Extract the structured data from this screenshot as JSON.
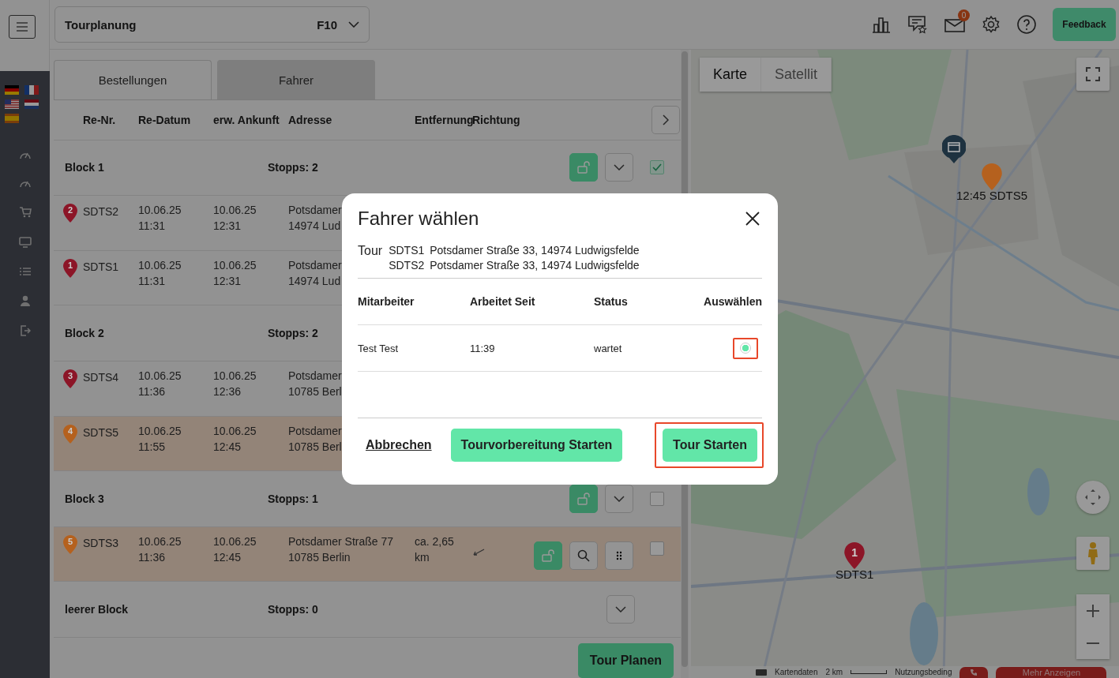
{
  "header": {
    "module_select": {
      "value": "Tourplanung",
      "shortcut": "F10"
    },
    "mail_badge": "0",
    "feedback_button": "Feedback"
  },
  "tabs": [
    {
      "label": "Bestellungen",
      "selected": false
    },
    {
      "label": "Fahrer",
      "selected": true
    }
  ],
  "table": {
    "columns": [
      "Re-Nr.",
      "Re-Datum",
      "erw. Ankunft",
      "Adresse",
      "Entfernung",
      "Richtung"
    ],
    "blocks": [
      {
        "name": "Block 1",
        "stops_label": "Stopps: 2",
        "kind": "full",
        "checked": true,
        "stops": [
          {
            "marker": "2",
            "color": "#8c1527",
            "id": "SDTS2",
            "date": "10.06.25",
            "date_time": "11:31",
            "arrival": "10.06.25",
            "arrival_time": "12:31",
            "address": [
              "Potsdamer",
              "14974 Lud"
            ],
            "highlighted": false
          },
          {
            "marker": "1",
            "color": "#8c1527",
            "id": "SDTS1",
            "date": "10.06.25",
            "date_time": "11:31",
            "arrival": "10.06.25",
            "arrival_time": "12:31",
            "address": [
              "Potsdamer",
              "14974 Lud"
            ],
            "highlighted": false
          }
        ]
      },
      {
        "name": "Block 2",
        "stops_label": "Stopps: 2",
        "stops": [
          {
            "marker": "3",
            "color": "#8c1527",
            "id": "SDTS4",
            "date": "10.06.25",
            "date_time": "11:36",
            "arrival": "10.06.25",
            "arrival_time": "12:36",
            "address": [
              "Potsdamer",
              "10785 Berl"
            ],
            "highlighted": false
          },
          {
            "marker": "4",
            "color": "#b5611e",
            "id": "SDTS5",
            "date": "10.06.25",
            "date_time": "11:55",
            "arrival": "10.06.25",
            "arrival_time": "12:45",
            "address": [
              "Potsdamer",
              "10785 Berl"
            ],
            "highlighted": true
          }
        ]
      },
      {
        "name": "Block 3",
        "stops_label": "Stopps: 1",
        "kind": "full",
        "checked": false,
        "stops": [
          {
            "marker": "5",
            "color": "#b5611e",
            "id": "SDTS3",
            "date": "10.06.25",
            "date_time": "11:36",
            "arrival": "10.06.25",
            "arrival_time": "12:45",
            "address": [
              "Potsdamer Straße 77",
              "10785 Berlin"
            ],
            "distance": [
              "ca. 2,65",
              "km"
            ],
            "checked": false,
            "highlighted": true
          }
        ]
      },
      {
        "name": "leerer Block",
        "stops_label": "Stopps: 0",
        "kind": "caret"
      }
    ],
    "plan_button": "Tour Planen"
  },
  "map": {
    "type_tabs": [
      {
        "label": "Karte",
        "selected": true
      },
      {
        "label": "Satellit",
        "selected": false
      }
    ],
    "markers": [
      {
        "kind": "store",
        "color": "#1e3240"
      },
      {
        "kind": "pin",
        "label": "12:45 SDTS5",
        "color": "#b5611e"
      },
      {
        "kind": "pin",
        "number": "1",
        "label": "SDTS1",
        "color": "#8c1527"
      }
    ],
    "footer": {
      "data": "Kartendaten",
      "scale": "2 km",
      "terms": "Nutzungsbeding",
      "more": "Mehr Anzeigen"
    }
  },
  "dialog": {
    "title": "Fahrer wählen",
    "tour_label": "Tour",
    "tour": [
      {
        "id": "SDTS1",
        "address": "Potsdamer Straße 33, 14974 Ludwigsfelde"
      },
      {
        "id": "SDTS2",
        "address": "Potsdamer Straße 33, 14974 Ludwigsfelde"
      }
    ],
    "columns": [
      "Mitarbeiter",
      "Arbeitet Seit",
      "Status",
      "Auswählen"
    ],
    "drivers": [
      {
        "name": "Test Test",
        "since": "11:39",
        "status": "wartet",
        "selected": true,
        "highlighted": true
      }
    ],
    "buttons": [
      {
        "kind": "link",
        "label": "Abbrechen"
      },
      {
        "kind": "primary",
        "label": "Tourvorbereitung Starten"
      },
      {
        "kind": "primary",
        "label": "Tour Starten",
        "highlighted": true
      }
    ]
  }
}
